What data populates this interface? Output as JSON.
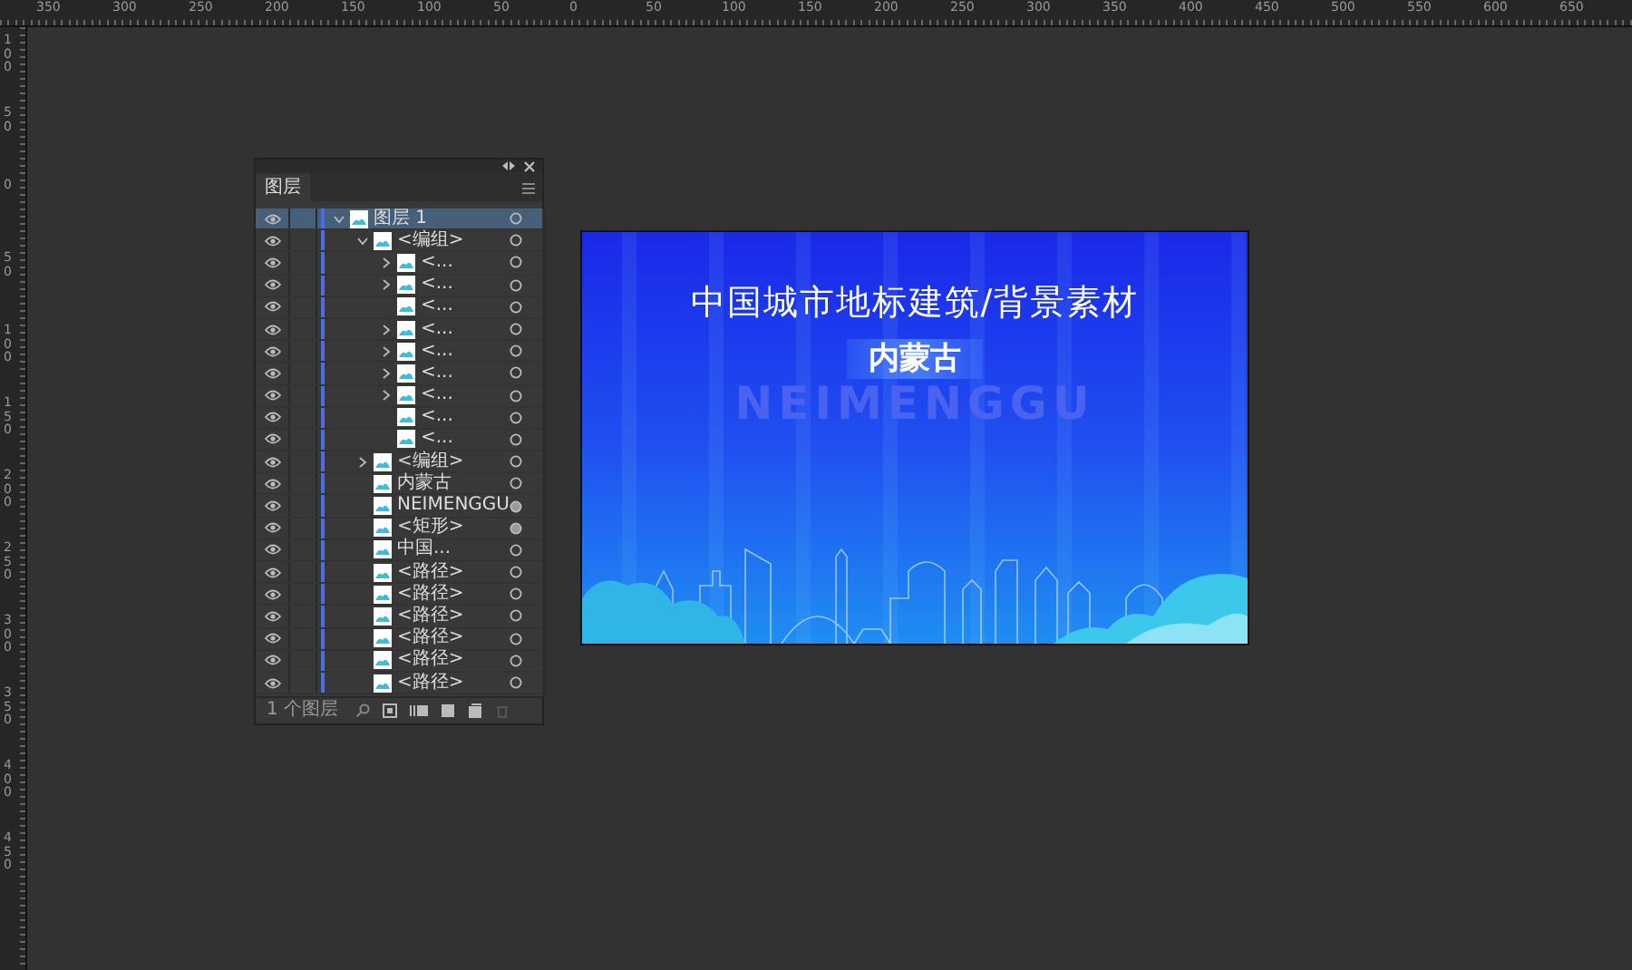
{
  "top_ruler": {
    "labels": [
      "350",
      "300",
      "250",
      "200",
      "150",
      "100",
      "50",
      "0",
      "50",
      "100",
      "150",
      "200",
      "250",
      "300",
      "350",
      "400",
      "450",
      "500",
      "550",
      "600",
      "650"
    ]
  },
  "left_ruler": {
    "labels": [
      "100",
      "50",
      "0",
      "50",
      "100",
      "150",
      "200",
      "250",
      "300",
      "350",
      "400",
      "450"
    ]
  },
  "layers_panel": {
    "tab": "图层",
    "layers": [
      {
        "name": "图层 1",
        "expanded": true,
        "selected": true,
        "appearance": false,
        "children": [
          {
            "name": "<编组>",
            "expanded": true,
            "selected": false,
            "appearance": false,
            "children": [
              {
                "name": "<...",
                "expanded": false,
                "selected": false,
                "appearance": false
              },
              {
                "name": "<...",
                "expanded": false,
                "selected": false,
                "appearance": false
              },
              {
                "name": "<...",
                "selected": false,
                "appearance": false
              },
              {
                "name": "<...",
                "expanded": false,
                "selected": false,
                "appearance": false
              },
              {
                "name": "<...",
                "expanded": false,
                "selected": false,
                "appearance": false
              },
              {
                "name": "<...",
                "expanded": false,
                "selected": false,
                "appearance": false
              },
              {
                "name": "<...",
                "expanded": false,
                "selected": false,
                "appearance": false
              },
              {
                "name": "<...",
                "selected": false,
                "appearance": false
              },
              {
                "name": "<...",
                "selected": false,
                "appearance": false
              }
            ]
          },
          {
            "name": "<编组>",
            "expanded": false,
            "selected": false,
            "appearance": false
          },
          {
            "name": "内蒙古",
            "selected": false,
            "appearance": false
          },
          {
            "name": "NEIMENGGU",
            "selected": false,
            "appearance": true
          },
          {
            "name": "<矩形>",
            "selected": false,
            "appearance": true
          },
          {
            "name": "中国...",
            "selected": false,
            "appearance": false
          },
          {
            "name": "<路径>",
            "selected": false,
            "appearance": false
          },
          {
            "name": "<路径>",
            "selected": false,
            "appearance": false
          },
          {
            "name": "<路径>",
            "selected": false,
            "appearance": false
          },
          {
            "name": "<路径>",
            "selected": false,
            "appearance": false
          },
          {
            "name": "<路径>",
            "selected": false,
            "appearance": false
          },
          {
            "name": "<路径>",
            "selected": false,
            "appearance": false
          }
        ]
      }
    ],
    "footer": {
      "count": "1 个图层"
    }
  },
  "artboard": {
    "title": "中国城市地标建筑/背景素材",
    "badge": "内蒙古",
    "watermark": "NEIMENGGU"
  }
}
